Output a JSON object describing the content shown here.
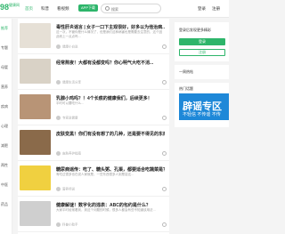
{
  "header": {
    "logo": "98",
    "logo_sub": "健康网",
    "nav": [
      "首页",
      "科普",
      "看视频",
      "APP下载"
    ],
    "search_placeholder": "搜索",
    "login": "登录",
    "register": "注册"
  },
  "left_categories": [
    "推荐",
    "专题",
    "母婴",
    "营养",
    "疾病",
    "心理",
    "减肥",
    "两性",
    "中医",
    "药品"
  ],
  "feed": [
    {
      "title": "毒性肝炎谣言 | 女子一口下主观很好，好多以为他治病...",
      "desc": "这一次，不管你是什么情况了，但是我们这种病害也是需要去注意的，这个因此而上一点点吗…",
      "author": "健康小白说",
      "thumb": "#e6e0d6"
    },
    {
      "title": "经常熬夜！大都有没都变吗？你心明气大吃不消...",
      "desc": "",
      "author": "健康生活分享",
      "thumb": "#d9d2c6"
    },
    {
      "title": "乳腺小鸡吗？！4个长痕的健康我们，后续更多！",
      "desc": "平时可以要吃什么…",
      "author": "专家说健康",
      "thumb": "#b89476"
    },
    {
      "title": "皮肤变黑！你们有没有想了的几种，还是要不得见的东西",
      "desc": "",
      "author": "皮肤养护指南",
      "thumb": "#8a6a4a"
    },
    {
      "title": "糖尿病谣传：吃了、糖头粥、孔渠，都要适合吃蔬菜是？",
      "desc": "有吃过很多也在说人家就是，一些东西很多人到是容这…",
      "author": "营养师说",
      "thumb": "#f0d040"
    },
    {
      "title": "健康解谜！数字化的违表：ABC的包约是什么？",
      "desc": "大家平时经常看到，到这个问题的时候，很多人都会有些不知道该用法…",
      "author": "科普小助手",
      "thumb": "#cfcfcf"
    }
  ],
  "sidebar": {
    "login_prompt": "登录后发现更多精彩",
    "login_btn": "登录",
    "register_btn": "注册",
    "week_title": "一周热帖",
    "hot_title": "热门话题",
    "banner_big": "辟谣专区",
    "banner_small": "不轻信 不传谣 不传"
  }
}
